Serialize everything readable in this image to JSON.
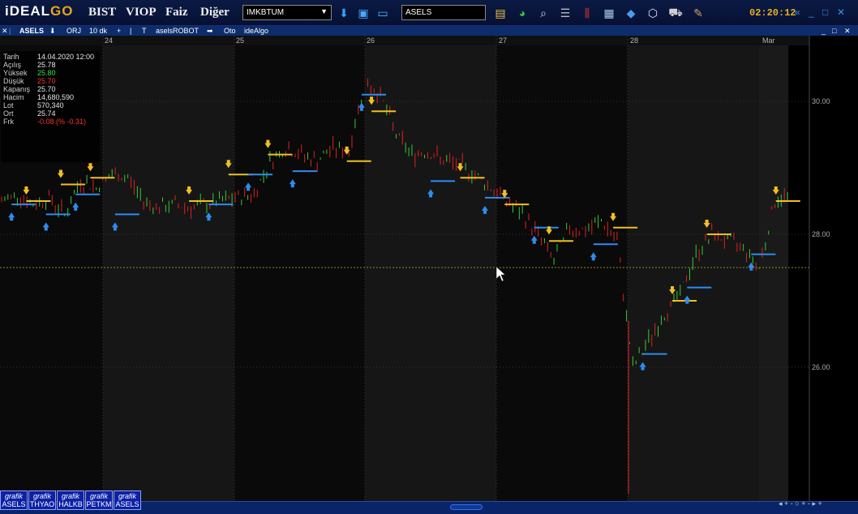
{
  "app": {
    "logo_main": "iDEAL",
    "logo_go": "GO"
  },
  "menu": [
    "BIST",
    "VIOP",
    "Faiz",
    "Diğer"
  ],
  "market_select": "IMKBTUM",
  "symbol_input": "ASELS",
  "clock": "02:20:12",
  "icons": [
    "download-icon",
    "save-icon",
    "monitor-icon",
    "notes-icon",
    "pie-chart-icon",
    "search-icon",
    "list-icon",
    "candles-icon",
    "dashboard-icon",
    "chat-icon",
    "cube-icon",
    "cart-icon",
    "brush-icon"
  ],
  "toolbar": {
    "symbol": "ASELS",
    "arrow": "⬇",
    "mode": "ORJ",
    "period": "10 dk",
    "plus": "+",
    "bar": "|",
    "t": "T",
    "robot": "aselsROBOT",
    "go": "➡",
    "auto": "Oto",
    "algo": "ideAlgo"
  },
  "databox": [
    {
      "k": "Tarih",
      "v": "14.04.2020 12:00",
      "c": ""
    },
    {
      "k": "Açılış",
      "v": "25.78",
      "c": ""
    },
    {
      "k": "Yüksek",
      "v": "25.80",
      "c": "up"
    },
    {
      "k": "Düşük",
      "v": "25.70",
      "c": "dn"
    },
    {
      "k": "Kapanış",
      "v": "25.70",
      "c": ""
    },
    {
      "k": "Hacim",
      "v": "14,680,590",
      "c": ""
    },
    {
      "k": "Lot",
      "v": "570,340",
      "c": ""
    },
    {
      "k": "Ort",
      "v": "25.74",
      "c": ""
    },
    {
      "k": "Frk",
      "v": "-0.08 (% -0.31)",
      "c": "dn"
    }
  ],
  "chart_data": {
    "type": "bar",
    "x_labels": [
      "24",
      "25",
      "26",
      "27",
      "28",
      "Mar"
    ],
    "y_ticks": [
      26.0,
      28.0,
      30.0
    ],
    "ylim": [
      24.0,
      31.0
    ],
    "reference_line": 27.5,
    "colors": {
      "up": "#33cc33",
      "down": "#e02020",
      "buy_line": "#2d8cf0",
      "sell_line": "#f0c020"
    },
    "closes": [
      28.5,
      28.6,
      28.45,
      28.55,
      28.3,
      28.8,
      28.7,
      28.9,
      28.85,
      28.5,
      28.4,
      28.45,
      28.4,
      28.45,
      28.5,
      28.55,
      28.6,
      29.1,
      29.3,
      29.2,
      29.1,
      29.3,
      29.25,
      30.3,
      30.1,
      29.5,
      29.2,
      29.25,
      29.1,
      29.05,
      28.9,
      28.7,
      28.5,
      28.3,
      28.0,
      27.6,
      28.1,
      28.05,
      28.2,
      27.9,
      26.0,
      26.4,
      26.8,
      27.1,
      27.7,
      28.0,
      27.9,
      27.8,
      27.5,
      28.5,
      28.6
    ],
    "signals": [
      {
        "t": "buy",
        "x": 0.02,
        "y": 28.45
      },
      {
        "t": "sell",
        "x": 0.05,
        "y": 28.5
      },
      {
        "t": "buy",
        "x": 0.09,
        "y": 28.3
      },
      {
        "t": "sell",
        "x": 0.12,
        "y": 28.75
      },
      {
        "t": "buy",
        "x": 0.15,
        "y": 28.6
      },
      {
        "t": "sell",
        "x": 0.18,
        "y": 28.85
      },
      {
        "t": "buy",
        "x": 0.23,
        "y": 28.3
      },
      {
        "t": "sell",
        "x": 0.38,
        "y": 28.5
      },
      {
        "t": "buy",
        "x": 0.42,
        "y": 28.45
      },
      {
        "t": "sell",
        "x": 0.46,
        "y": 28.9
      },
      {
        "t": "buy",
        "x": 0.5,
        "y": 28.9
      },
      {
        "t": "sell",
        "x": 0.54,
        "y": 29.2
      },
      {
        "t": "buy",
        "x": 0.59,
        "y": 28.95
      },
      {
        "t": "sell",
        "x": 0.7,
        "y": 29.1
      },
      {
        "t": "buy",
        "x": 0.73,
        "y": 30.1
      },
      {
        "t": "sell",
        "x": 0.75,
        "y": 29.85
      },
      {
        "t": "buy",
        "x": 0.87,
        "y": 28.8
      },
      {
        "t": "sell",
        "x": 0.93,
        "y": 28.85
      },
      {
        "t": "buy",
        "x": 0.98,
        "y": 28.55
      },
      {
        "t": "sell",
        "x": 1.02,
        "y": 28.45
      },
      {
        "t": "buy",
        "x": 1.08,
        "y": 28.1
      },
      {
        "t": "sell",
        "x": 1.11,
        "y": 27.9
      },
      {
        "t": "buy",
        "x": 1.2,
        "y": 27.85
      },
      {
        "t": "sell",
        "x": 1.24,
        "y": 28.1
      },
      {
        "t": "buy",
        "x": 1.3,
        "y": 26.2
      },
      {
        "t": "sell",
        "x": 1.36,
        "y": 27.0
      },
      {
        "t": "buy",
        "x": 1.39,
        "y": 27.2
      },
      {
        "t": "sell",
        "x": 1.43,
        "y": 28.0
      },
      {
        "t": "buy",
        "x": 1.52,
        "y": 27.7
      },
      {
        "t": "sell",
        "x": 1.57,
        "y": 28.5
      }
    ]
  },
  "tabs": [
    {
      "top": "grafik",
      "bottom": "ASELS"
    },
    {
      "top": "grafik",
      "bottom": "THYAO"
    },
    {
      "top": "grafik",
      "bottom": "HALKB"
    },
    {
      "top": "grafik",
      "bottom": "PETKM"
    },
    {
      "top": "grafik",
      "bottom": "ASELS"
    }
  ],
  "nav": "◂ + - ○ + - ▸ +"
}
